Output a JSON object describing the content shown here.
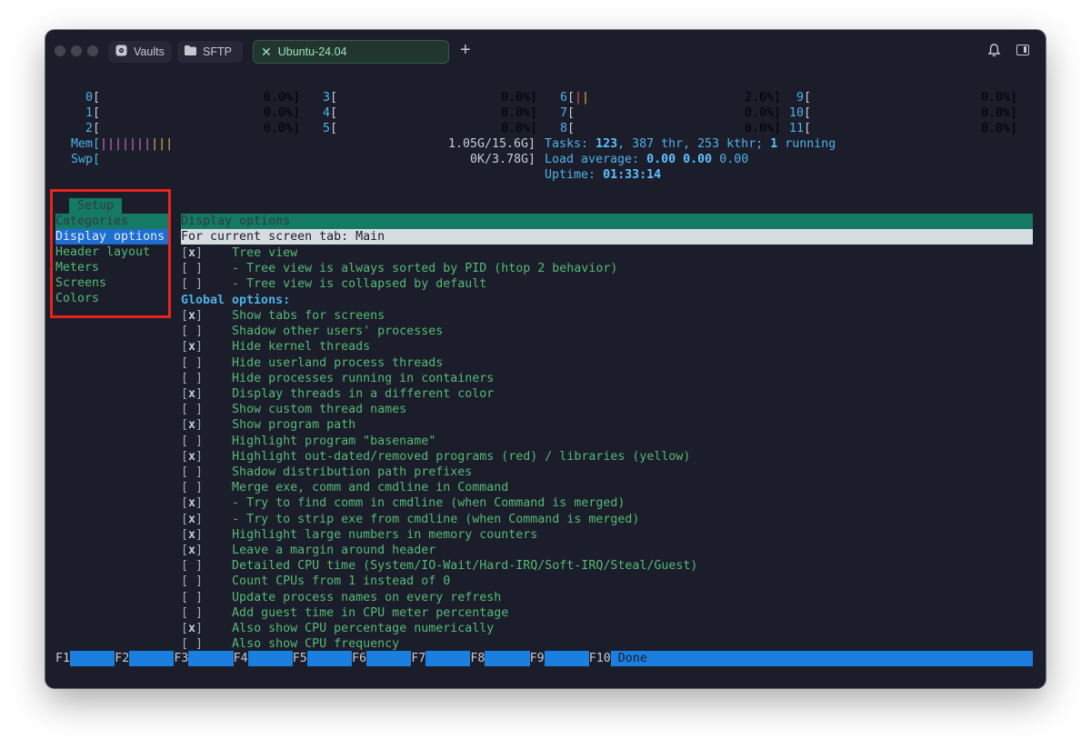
{
  "window": {
    "tabs": [
      {
        "label": "Vaults",
        "icon": "vault-icon"
      },
      {
        "label": "SFTP",
        "icon": "folder-icon"
      },
      {
        "label": "Ubuntu-24.04",
        "icon": "close-icon",
        "active": true
      }
    ],
    "new_tab_symbol": "+"
  },
  "cpu": [
    {
      "id": "0",
      "pct": "0.0%]"
    },
    {
      "id": "1",
      "pct": "0.0%]"
    },
    {
      "id": "2",
      "pct": "0.0%]"
    },
    {
      "id": "3",
      "pct": "0.0%]"
    },
    {
      "id": "4",
      "pct": "0.0%]"
    },
    {
      "id": "5",
      "pct": "0.0%]"
    },
    {
      "id": "6",
      "pct": "2.6%]"
    },
    {
      "id": "7",
      "pct": "0.0%]"
    },
    {
      "id": "8",
      "pct": "0.0%]"
    },
    {
      "id": "9",
      "pct": "0.0%]"
    },
    {
      "id": "10",
      "pct": "0.0%]"
    },
    {
      "id": "11",
      "pct": "0.0%]"
    }
  ],
  "mem": {
    "label": "Mem[",
    "bars": "||||||||||",
    "value": "1.05G/15.6G]"
  },
  "swp": {
    "label": "Swp[",
    "value": "0K/3.78G]"
  },
  "tasks": {
    "prefix": "Tasks:",
    "count": "123",
    "thr": ", 387 thr, 253 kthr; ",
    "running_n": "1",
    "running": " running"
  },
  "load": {
    "prefix": "Load average:",
    "a": "0.00",
    "b": "0.00",
    "c": "0.00"
  },
  "uptime": {
    "prefix": "Uptime:",
    "value": "01:33:14"
  },
  "setup": {
    "tab_label": "Setup",
    "categories_header": "Categories",
    "categories": [
      "Display options",
      "Header layout",
      "Meters",
      "Screens",
      "Colors"
    ],
    "selected_category": "Display options"
  },
  "options": {
    "header": "Display options",
    "screen_tab_line": "For current screen tab: Main",
    "screen_items": [
      {
        "checked": true,
        "label": "Tree view"
      },
      {
        "checked": false,
        "label": "- Tree view is always sorted by PID (htop 2 behavior)"
      },
      {
        "checked": false,
        "label": "- Tree view is collapsed by default"
      }
    ],
    "global_label": "Global options:",
    "global_items": [
      {
        "checked": true,
        "label": "Show tabs for screens"
      },
      {
        "checked": false,
        "label": "Shadow other users' processes"
      },
      {
        "checked": true,
        "label": "Hide kernel threads"
      },
      {
        "checked": false,
        "label": "Hide userland process threads"
      },
      {
        "checked": false,
        "label": "Hide processes running in containers"
      },
      {
        "checked": true,
        "label": "Display threads in a different color"
      },
      {
        "checked": false,
        "label": "Show custom thread names"
      },
      {
        "checked": true,
        "label": "Show program path"
      },
      {
        "checked": false,
        "label": "Highlight program \"basename\""
      },
      {
        "checked": true,
        "label": "Highlight out-dated/removed programs (red) / libraries (yellow)"
      },
      {
        "checked": false,
        "label": "Shadow distribution path prefixes"
      },
      {
        "checked": false,
        "label": "Merge exe, comm and cmdline in Command"
      },
      {
        "checked": true,
        "label": "- Try to find comm in cmdline (when Command is merged)"
      },
      {
        "checked": true,
        "label": "- Try to strip exe from cmdline (when Command is merged)"
      },
      {
        "checked": true,
        "label": "Highlight large numbers in memory counters"
      },
      {
        "checked": true,
        "label": "Leave a margin around header"
      },
      {
        "checked": false,
        "label": "Detailed CPU time (System/IO-Wait/Hard-IRQ/Soft-IRQ/Steal/Guest)"
      },
      {
        "checked": false,
        "label": "Count CPUs from 1 instead of 0"
      },
      {
        "checked": false,
        "label": "Update process names on every refresh"
      },
      {
        "checked": false,
        "label": "Add guest time in CPU meter percentage"
      },
      {
        "checked": true,
        "label": "Also show CPU percentage numerically"
      },
      {
        "checked": false,
        "label": "Also show CPU frequency"
      }
    ]
  },
  "fkeys": [
    "F1",
    "F2",
    "F3",
    "F4",
    "F5",
    "F6",
    "F7",
    "F8",
    "F9",
    "F10"
  ],
  "fkey_done": "Done",
  "colors": {
    "accent_green": "#157a63",
    "selection_blue": "#1e6ed1",
    "highlight_red": "#e8241d"
  }
}
